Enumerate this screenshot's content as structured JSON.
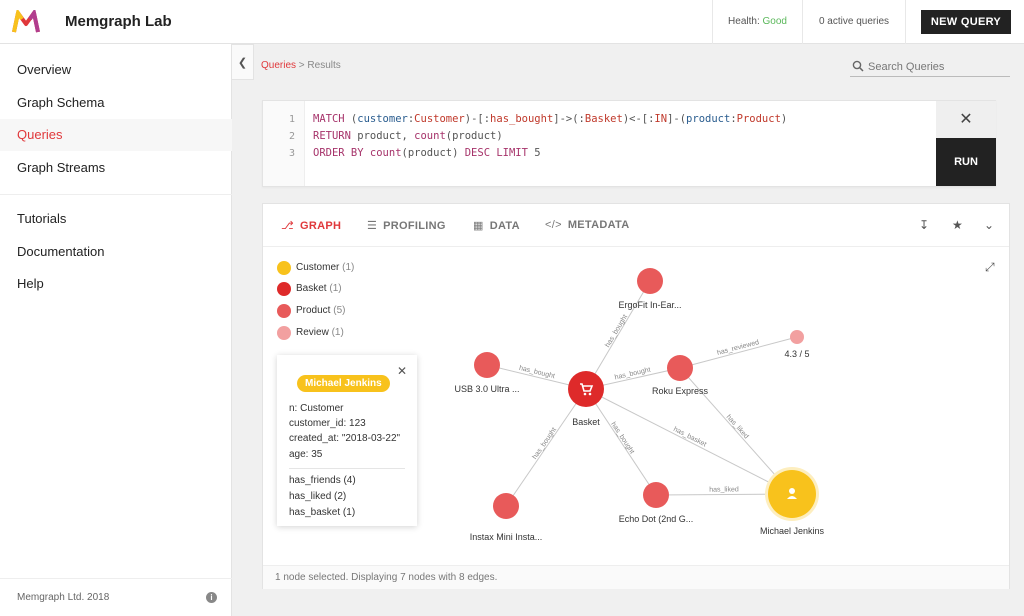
{
  "header": {
    "app_title": "Memgraph Lab",
    "health_label": "Health:",
    "health_value": "Good",
    "active_queries": "0 active queries",
    "new_query_label": "NEW QUERY"
  },
  "sidebar": {
    "items": [
      {
        "label": "Overview"
      },
      {
        "label": "Graph Schema"
      },
      {
        "label": "Queries"
      },
      {
        "label": "Graph Streams"
      },
      {
        "label": "Tutorials"
      },
      {
        "label": "Documentation"
      },
      {
        "label": "Help"
      }
    ],
    "active_item": "Queries",
    "footer": "Memgraph Ltd. 2018"
  },
  "breadcrumb": {
    "link": "Queries",
    "separator": " > ",
    "current": "Results"
  },
  "search": {
    "placeholder": "Search Queries"
  },
  "editor": {
    "line_numbers": [
      "1",
      "2",
      "3"
    ],
    "run_label": "RUN",
    "clear_icon": "close-icon"
  },
  "tabs": [
    {
      "label": "GRAPH",
      "icon": "graph-icon"
    },
    {
      "label": "PROFILING",
      "icon": "profiling-icon"
    },
    {
      "label": "DATA",
      "icon": "table-icon"
    },
    {
      "label": "METADATA",
      "icon": "code-icon"
    }
  ],
  "active_tab": "GRAPH",
  "legend": [
    {
      "label": "Customer",
      "count": "(1)",
      "color": "#f8c21c"
    },
    {
      "label": "Basket",
      "count": "(1)",
      "color": "#de2a2a"
    },
    {
      "label": "Product",
      "count": "(5)",
      "color": "#e85a5a"
    },
    {
      "label": "Review",
      "count": "(1)",
      "color": "#f2a0a0"
    }
  ],
  "node_card": {
    "badge": "Michael Jenkins",
    "properties": [
      "n: Customer",
      "customer_id: 123",
      "created_at: \"2018-03-22\"",
      "age: 35"
    ],
    "relations": [
      "has_friends (4)",
      "has_liked (2)",
      "has_basket (1)"
    ]
  },
  "graph": {
    "nodes": [
      {
        "id": "basket",
        "label": "Basket",
        "kind": "basket"
      },
      {
        "id": "ergofit",
        "label": "ErgoFit In-Ear...",
        "kind": "product"
      },
      {
        "id": "usb",
        "label": "USB 3.0 Ultra ...",
        "kind": "product"
      },
      {
        "id": "roku",
        "label": "Roku Express",
        "kind": "product"
      },
      {
        "id": "review",
        "label": "4.3 / 5",
        "kind": "review"
      },
      {
        "id": "instax",
        "label": "Instax Mini Insta...",
        "kind": "product"
      },
      {
        "id": "echo",
        "label": "Echo Dot (2nd G...",
        "kind": "product"
      },
      {
        "id": "michael",
        "label": "Michael Jenkins",
        "kind": "customer"
      }
    ],
    "edges": [
      {
        "from": "basket",
        "to": "ergofit",
        "label": "has_bought"
      },
      {
        "from": "basket",
        "to": "usb",
        "label": "has_bought"
      },
      {
        "from": "basket",
        "to": "roku",
        "label": "has_bought"
      },
      {
        "from": "basket",
        "to": "instax",
        "label": "has_bought"
      },
      {
        "from": "basket",
        "to": "echo",
        "label": "has_bought"
      },
      {
        "from": "basket",
        "to": "michael",
        "label": "has_basket"
      },
      {
        "from": "roku",
        "to": "review",
        "label": "has_reviewed"
      },
      {
        "from": "roku",
        "to": "michael",
        "label": "has_liked"
      },
      {
        "from": "echo",
        "to": "michael",
        "label": "has_liked"
      }
    ]
  },
  "status": "1 node selected. Displaying 7 nodes with 8 edges."
}
